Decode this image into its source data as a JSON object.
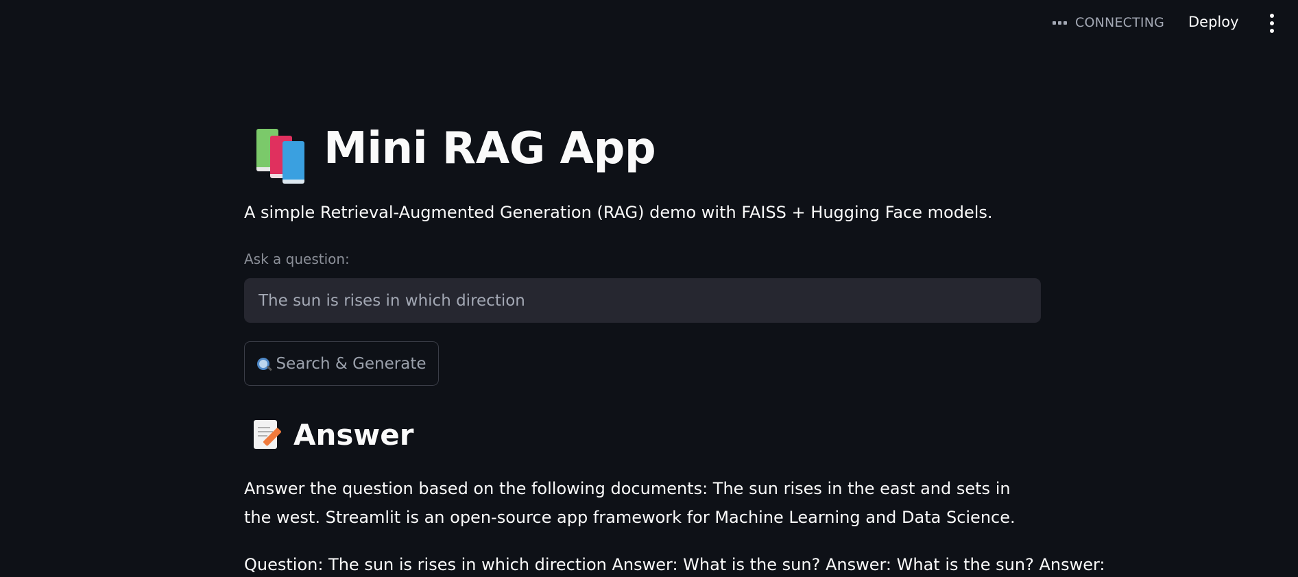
{
  "header": {
    "status_text": "CONNECTING",
    "deploy_label": "Deploy"
  },
  "main": {
    "title": "Mini RAG App",
    "title_icon": "books-emoji",
    "subtitle": "A simple Retrieval-Augmented Generation (RAG) demo with FAISS + Hugging Face models.",
    "question_label": "Ask a question:",
    "question_value": "The sun is rises in which direction",
    "search_button_label": "Search & Generate",
    "search_button_icon": "magnifier-emoji",
    "answer_heading": "Answer",
    "answer_icon": "memo-emoji",
    "answer_paragraph_1": "Answer the question based on the following documents: The sun rises in the east and sets in the west. Streamlit is an open-source app framework for Machine Learning and Data Science.",
    "answer_paragraph_2": "Question: The sun is rises in which direction Answer: What is the sun? Answer: What is the sun? Answer:"
  },
  "colors": {
    "background": "#0e1117",
    "text": "#fafafa",
    "muted": "#a3a8b4",
    "input_bg": "#262730"
  }
}
